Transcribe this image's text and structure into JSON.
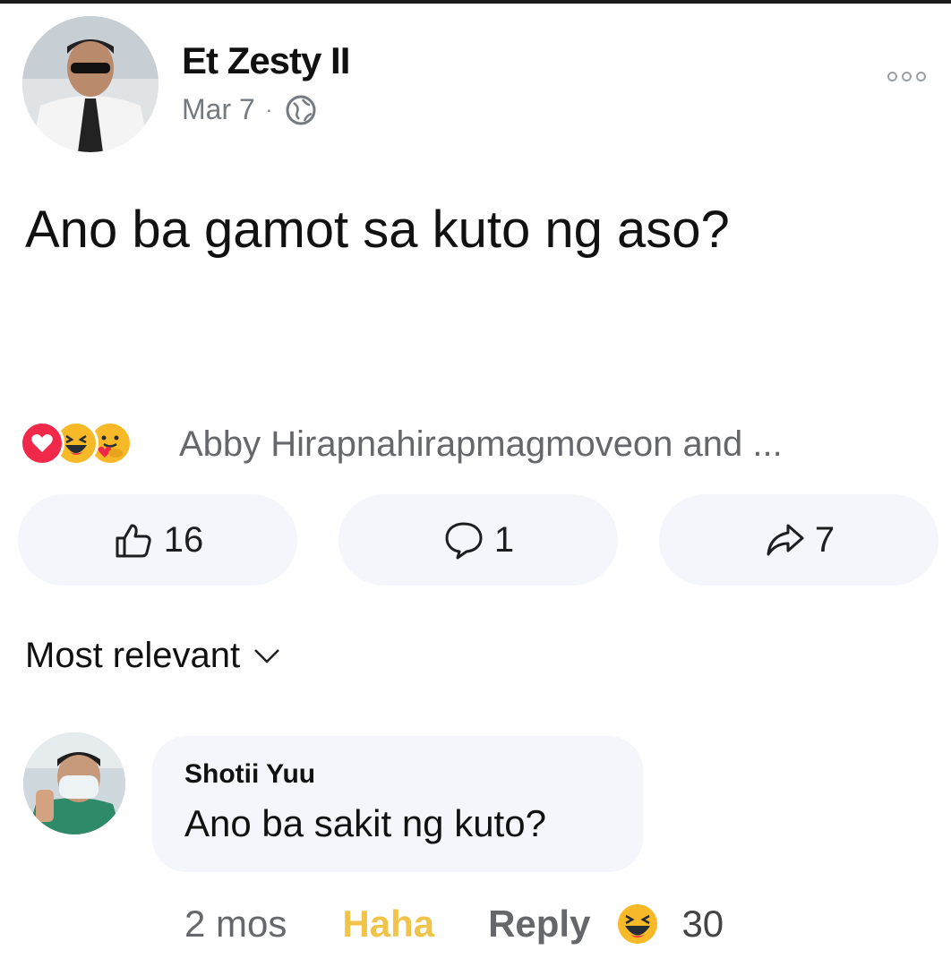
{
  "post": {
    "author": "Et Zesty II",
    "date": "Mar 7",
    "separator": "·",
    "text": "Ano ba gamot sa kuto ng aso?",
    "reactions_summary": "Abby Hirapnahirapmagmoveon and ...",
    "reaction_types": [
      "love-icon",
      "haha-icon",
      "care-icon"
    ],
    "like_count": "16",
    "comment_count": "1",
    "share_count": "7"
  },
  "comments_sort": "Most relevant",
  "comment": {
    "author": "Shotii Yuu",
    "text": "Ano ba sakit ng kuto?",
    "time": "2 mos",
    "reaction_label": "Haha",
    "reply_label": "Reply",
    "reaction_count": "30"
  },
  "colors": {
    "love": "#f0284a",
    "haha": "#f7b928",
    "haha_label": "#f0c44a",
    "button_bg": "#f4f6fb",
    "secondary_text": "#65676b"
  }
}
